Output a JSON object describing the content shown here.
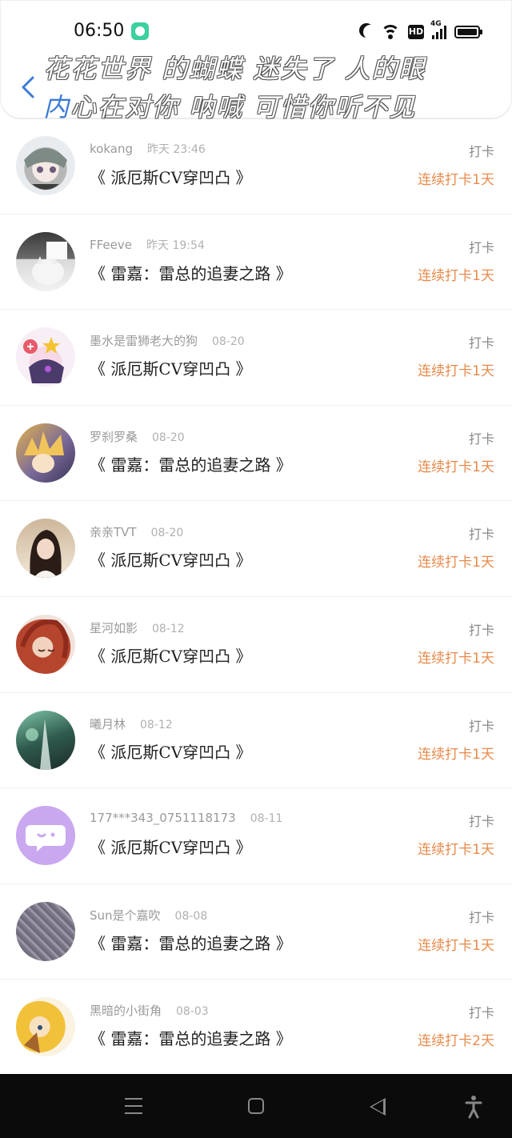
{
  "status_bar": {
    "time": "06:50",
    "network": "4G",
    "hd": "HD"
  },
  "header": {
    "overlay_line1": "花花世界 的蝴蝶 迷失了 人的眼",
    "overlay_line2_first": "内",
    "overlay_line2_rest": "心在对你 呐喊 可惜你听不见"
  },
  "colors": {
    "accent_orange": "#e88a4a",
    "back_blue": "#3a7bd5"
  },
  "list": [
    {
      "user": "kokang",
      "date": "昨天 23:46",
      "title": "《 派厄斯CV穿凹凸 》",
      "tag": "打卡",
      "streak": "连续打卡1天",
      "avatar": "anime-avatar"
    },
    {
      "user": "FFeeve",
      "date": "昨天 19:54",
      "title": "《 雷嘉：雷总的追妻之路 》",
      "tag": "打卡",
      "streak": "连续打卡1天",
      "avatar": "cat-avatar"
    },
    {
      "user": "墨水是雷狮老大的狗",
      "date": "08-20",
      "title": "《 派厄斯CV穿凹凸 》",
      "tag": "打卡",
      "streak": "连续打卡1天",
      "avatar": "anime-avatar"
    },
    {
      "user": "罗刹罗桑",
      "date": "08-20",
      "title": "《 雷嘉：雷总的追妻之路 》",
      "tag": "打卡",
      "streak": "连续打卡1天",
      "avatar": "anime-avatar"
    },
    {
      "user": "亲亲TVT",
      "date": "08-20",
      "title": "《 派厄斯CV穿凹凸 》",
      "tag": "打卡",
      "streak": "连续打卡1天",
      "avatar": "photo-avatar"
    },
    {
      "user": "星河如影",
      "date": "08-12",
      "title": "《 派厄斯CV穿凹凸 》",
      "tag": "打卡",
      "streak": "连续打卡1天",
      "avatar": "anime-avatar"
    },
    {
      "user": "曦月林",
      "date": "08-12",
      "title": "《 派厄斯CV穿凹凸 》",
      "tag": "打卡",
      "streak": "连续打卡1天",
      "avatar": "anime-avatar"
    },
    {
      "user": "177***343_0751118173",
      "date": "08-11",
      "title": "《 派厄斯CV穿凹凸 》",
      "tag": "打卡",
      "streak": "连续打卡1天",
      "avatar": "default-chat-avatar"
    },
    {
      "user": "Sun是个嘉吹",
      "date": "08-08",
      "title": "《 雷嘉：雷总的追妻之路 》",
      "tag": "打卡",
      "streak": "连续打卡1天",
      "avatar": "noise-avatar"
    },
    {
      "user": "黑暗的小街角",
      "date": "08-03",
      "title": "《 雷嘉：雷总的追妻之路 》",
      "tag": "打卡",
      "streak": "连续打卡2天",
      "avatar": "anime-avatar"
    }
  ]
}
